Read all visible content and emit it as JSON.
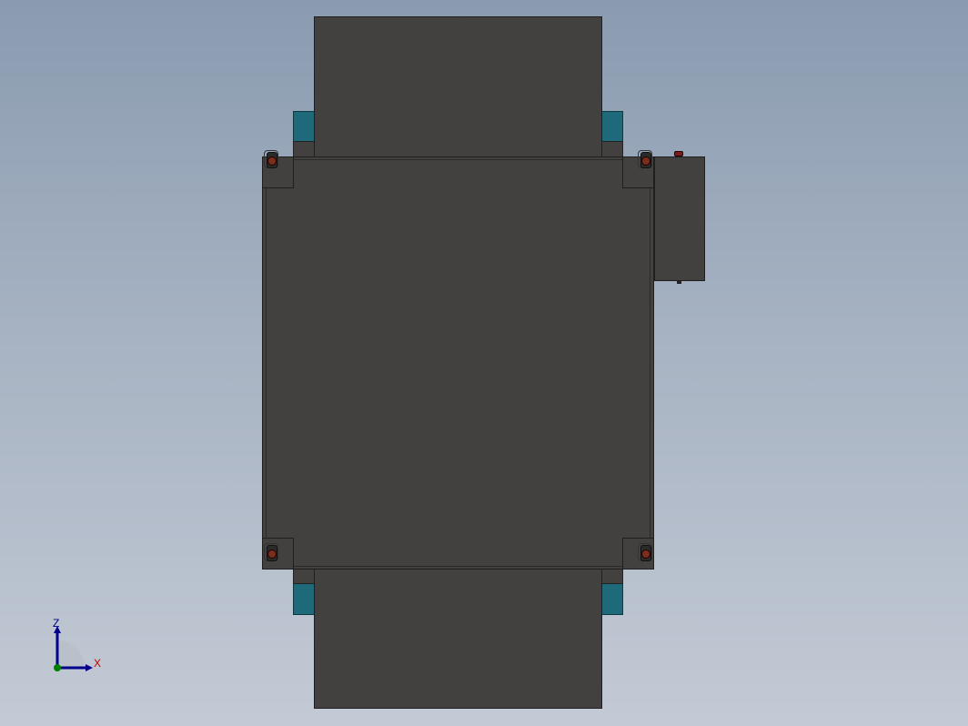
{
  "view": {
    "background_top": "#8a9bb0",
    "background_bottom": "#c3cad5",
    "body_color": "#434140",
    "bracket_color": "#1f6a7a",
    "caster_color": "#7a2e1c"
  },
  "triad": {
    "z_label": "Z",
    "x_label": "X",
    "z_color": "#00008b",
    "x_color": "#c00000",
    "y_color": "#008000"
  }
}
